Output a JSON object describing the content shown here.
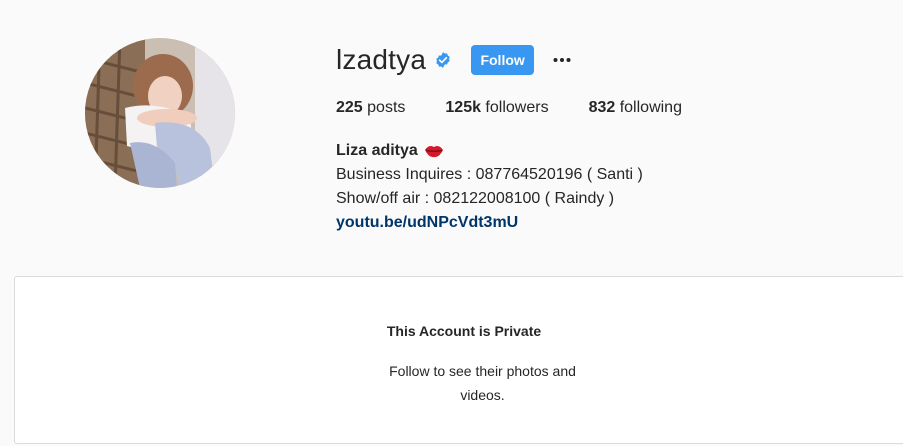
{
  "profile": {
    "username": "lzadtya",
    "follow_label": "Follow",
    "more_icon": "more-horizontal-icon",
    "verified_icon": "verified-badge-icon",
    "colors": {
      "follow_button": "#3897f0",
      "verified_badge": "#3897f0",
      "link": "#003569"
    }
  },
  "stats": {
    "posts_count": "225",
    "posts_label": " posts",
    "followers_count": "125k",
    "followers_label": " followers",
    "following_count": "832",
    "following_label": " following"
  },
  "bio": {
    "full_name": "Liza aditya",
    "emoji": "lips-emoji",
    "line1": "Business Inquires : 087764520196 ( Santi )",
    "line2": "Show/off air : 082122008100 ( Raindy )",
    "link": "youtu.be/udNPcVdt3mU"
  },
  "private_notice": {
    "title": "This Account is Private",
    "subtitle": "Follow to see their photos and videos."
  }
}
